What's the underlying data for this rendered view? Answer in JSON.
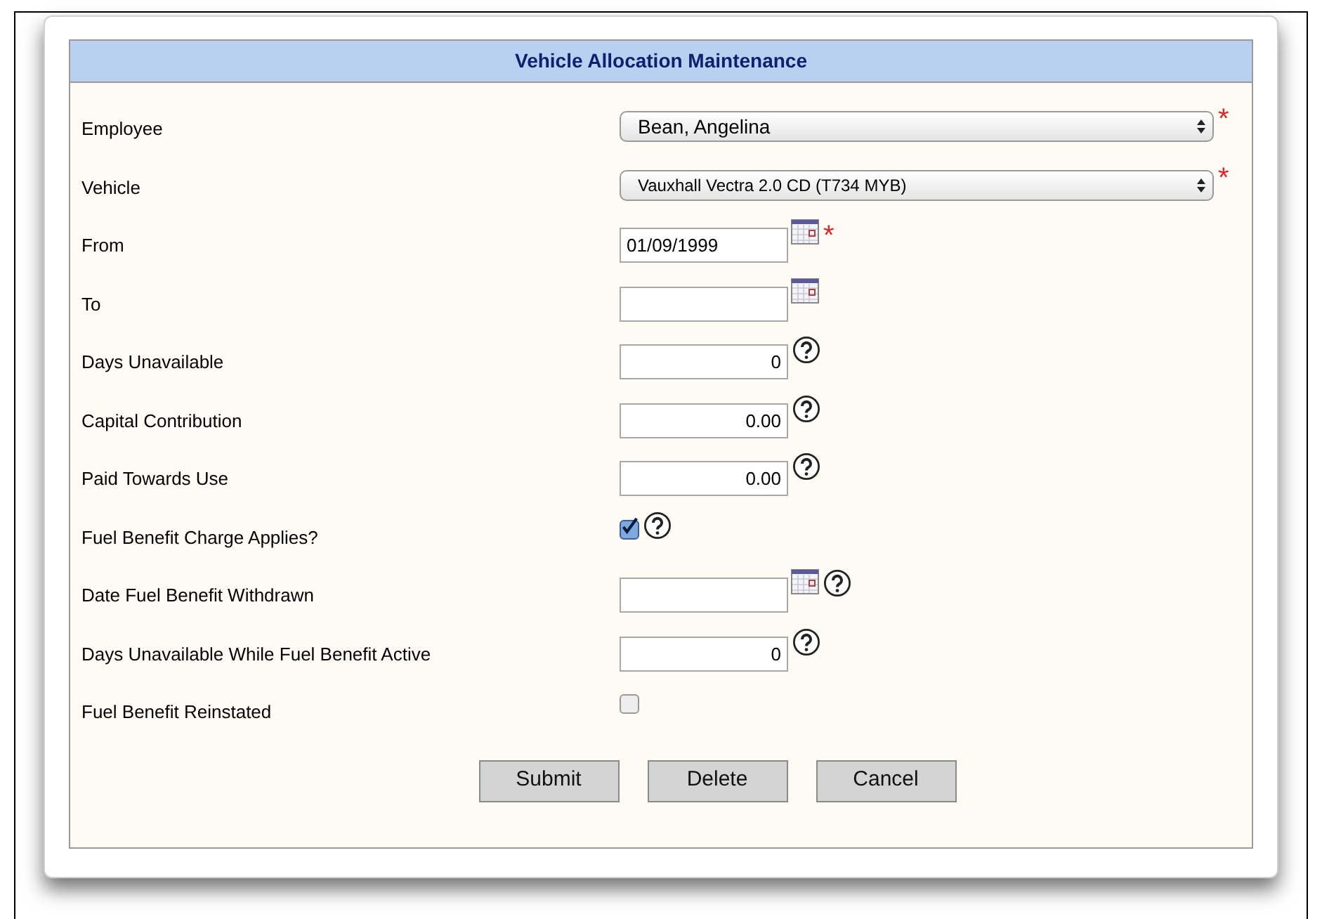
{
  "title": "Vehicle Allocation Maintenance",
  "fields": [
    {
      "label": "Employee",
      "kind": "select",
      "value": "Bean, Angelina",
      "required_mark": "*",
      "help": false
    },
    {
      "label": "Vehicle",
      "kind": "select",
      "value": "Vauxhall Vectra 2.0 CD (T734 MYB)",
      "required_mark": "*",
      "help": false
    },
    {
      "label": "From",
      "kind": "date",
      "value": "01/09/1999",
      "required_mark": "*",
      "help": false
    },
    {
      "label": "To",
      "kind": "date",
      "help": false
    },
    {
      "label": "Days Unavailable",
      "kind": "number",
      "value": "0",
      "help": true
    },
    {
      "label": "Capital Contribution",
      "kind": "number",
      "value": "0.00",
      "help": true
    },
    {
      "label": "Paid Towards Use",
      "kind": "number",
      "value": "0.00",
      "help": true
    },
    {
      "label": "Fuel Benefit Charge Applies?",
      "kind": "checkbox",
      "checked": true,
      "help": true
    },
    {
      "label": "Date Fuel Benefit Withdrawn",
      "kind": "date",
      "help": true
    },
    {
      "label": "Days Unavailable While Fuel Benefit Active",
      "kind": "number",
      "value": "0",
      "help": true
    },
    {
      "label": "Fuel Benefit Reinstated",
      "kind": "checkbox",
      "checked": false,
      "help": false
    }
  ],
  "buttons": [
    "Submit",
    "Delete",
    "Cancel"
  ]
}
